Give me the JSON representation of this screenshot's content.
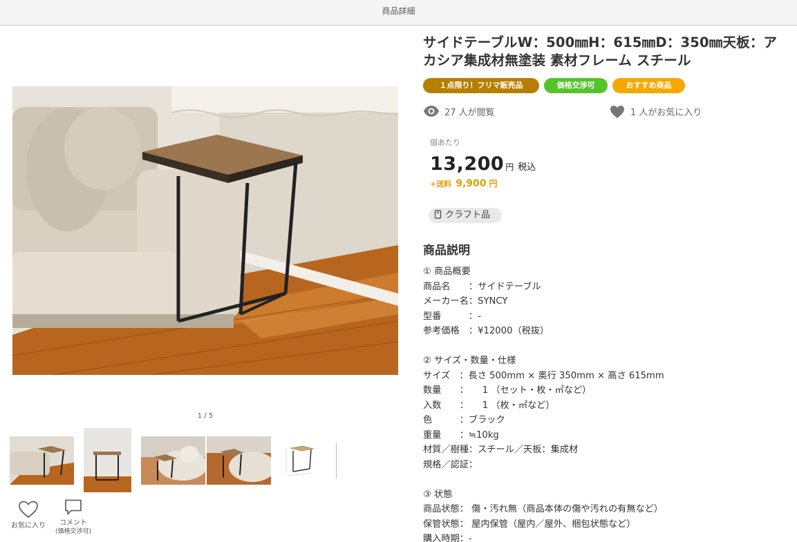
{
  "header": {
    "title": "商品詳細"
  },
  "gallery": {
    "pager": "1 / 5",
    "thumbnails": [
      "thumb-1",
      "thumb-2",
      "thumb-3",
      "thumb-4",
      "thumb-5"
    ]
  },
  "actions": {
    "favorite_label": "お気に入り",
    "comment_label": "コメント",
    "comment_sub": "(価格交渉可)"
  },
  "product": {
    "title": "サイドテーブルW：500㎜H：615㎜D：350㎜天板：アカシア集成材無塗装 素材フレーム スチール",
    "badges": [
      {
        "label": "１点限り！フリマ販売品",
        "color": "#b67f00"
      },
      {
        "label": "価格交渉可",
        "color": "#55c32a"
      },
      {
        "label": "おすすめ商品",
        "color": "#f5a800"
      }
    ],
    "views_text": "27 人が閲覧",
    "favorites_text": "1 人がお気に入り",
    "unit_label": "個あたり",
    "price": "13,200",
    "price_yen": "円",
    "tax_label": "税込",
    "shipping_label": "+送料",
    "shipping_value": "9,900",
    "shipping_yen": "円",
    "category_chip": "クラフト品",
    "description_title": "商品説明",
    "description_lines": [
      "① 商品概要",
      "商品名　　：サイドテーブル",
      "メーカー名：SYNCY",
      "型番　　　：-",
      "参考価格　：¥12000（税抜）",
      "",
      "② サイズ・数量・仕様",
      "サイズ　：長さ 500mm × 奥行 350mm × 高さ 615mm",
      "数量　　：　　1 （セット・枚・㎡など）",
      "入数　　：　　1 （枚・㎡など）",
      "色　　　：ブラック",
      "重量　　：≒10kg",
      "材質／樹種：スチール／天板：集成材",
      "規格／認証：",
      "",
      "③ 状態",
      "商品状態： 傷・汚れ無（商品本体の傷や汚れの有無など）",
      "保管状態： 屋内保管（屋内／屋外、梱包状態など）",
      "購入時期：-"
    ]
  },
  "icons": {
    "eye": "eye-icon",
    "heart": "heart-icon",
    "comment": "comment-icon",
    "tag": "tag-icon"
  }
}
